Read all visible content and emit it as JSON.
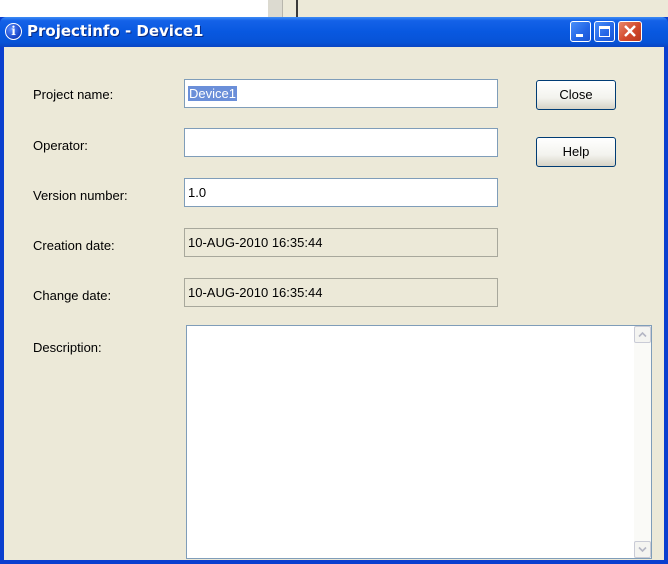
{
  "window": {
    "title": "Projectinfo - Device1",
    "title_icon_glyph": "i",
    "title_icon": "info-icon"
  },
  "fields": {
    "project_name": {
      "label": "Project name:",
      "value": "Device1"
    },
    "operator": {
      "label": "Operator:",
      "value": ""
    },
    "version_number": {
      "label": "Version number:",
      "value": "1.0"
    },
    "creation_date": {
      "label": "Creation date:",
      "value": "10-AUG-2010 16:35:44"
    },
    "change_date": {
      "label": "Change date:",
      "value": "10-AUG-2010 16:35:44"
    },
    "description": {
      "label": "Description:",
      "value": ""
    }
  },
  "buttons": {
    "close": "Close",
    "help": "Help"
  },
  "colors": {
    "titlebar": "#0858e0",
    "dialog_bg": "#ece9d8",
    "close_button": "#d2482c",
    "selection": "#6b8fd9"
  }
}
